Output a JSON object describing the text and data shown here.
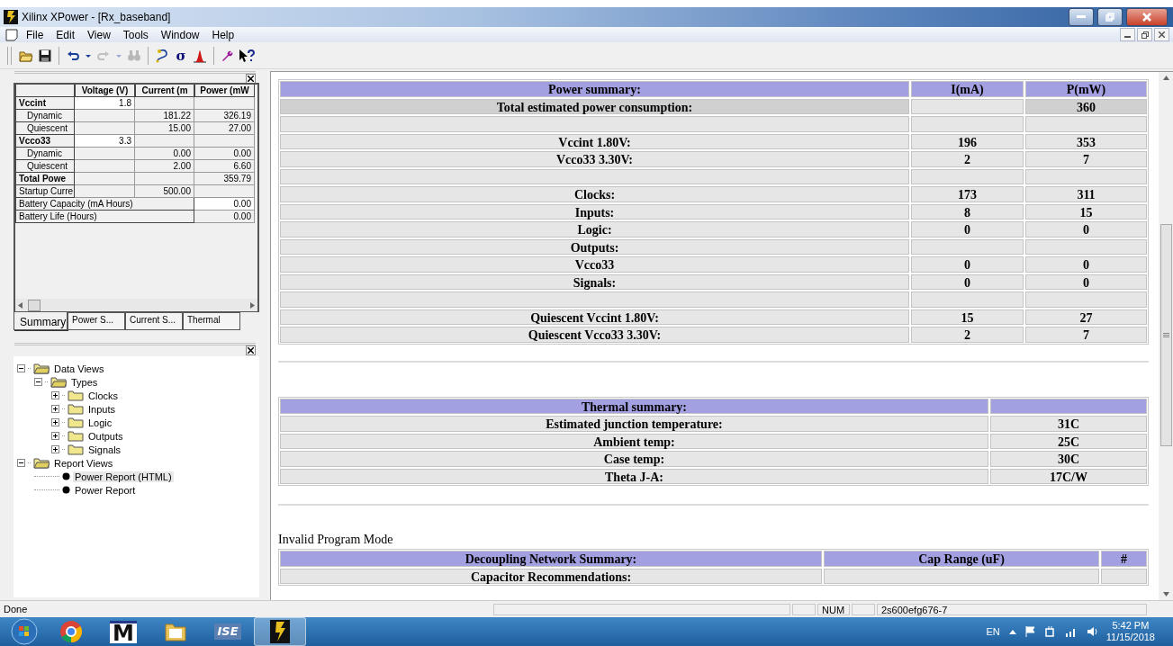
{
  "window": {
    "title": "Xilinx XPower - [Rx_baseband]"
  },
  "menu": [
    "File",
    "Edit",
    "View",
    "Tools",
    "Window",
    "Help"
  ],
  "toolbar": [
    {
      "kind": "open",
      "disabled": false
    },
    {
      "kind": "save",
      "disabled": false
    },
    {
      "kind": "sep"
    },
    {
      "kind": "undo",
      "disabled": false
    },
    {
      "kind": "drop",
      "disabled": false
    },
    {
      "kind": "redo",
      "disabled": true
    },
    {
      "kind": "drop",
      "disabled": true
    },
    {
      "kind": "find",
      "disabled": true
    },
    {
      "kind": "sep"
    },
    {
      "kind": "probe",
      "disabled": false
    },
    {
      "kind": "glyph",
      "text": "σ",
      "disabled": false
    },
    {
      "kind": "peak",
      "disabled": false
    },
    {
      "kind": "sep"
    },
    {
      "kind": "wrench",
      "disabled": false
    },
    {
      "kind": "help",
      "disabled": false
    }
  ],
  "grid": {
    "columns": [
      "Voltage (V)",
      "Current (m",
      "Power (mW"
    ],
    "rows": [
      {
        "kind": "group",
        "label": "Vccint",
        "voltage": "1.8"
      },
      {
        "kind": "sub",
        "label": "Dynamic",
        "current": "181.22",
        "power": "326.19"
      },
      {
        "kind": "sub",
        "label": "Quiescent",
        "current": "15.00",
        "power": "27.00"
      },
      {
        "kind": "group",
        "label": "Vcco33",
        "voltage": "3.3"
      },
      {
        "kind": "sub",
        "label": "Dynamic",
        "current": "0.00",
        "power": "0.00"
      },
      {
        "kind": "sub",
        "label": "Quiescent",
        "current": "2.00",
        "power": "6.60"
      },
      {
        "kind": "total",
        "label": "Total Powe",
        "power": "359.79"
      },
      {
        "kind": "plain",
        "label": "Startup Curre",
        "current": "500.00"
      },
      {
        "kind": "wide-input",
        "label": "Battery Capacity (mA Hours)",
        "value": "0.00"
      },
      {
        "kind": "wide",
        "label": "Battery Life (Hours)",
        "value": "0.00"
      }
    ]
  },
  "panel_tabs": [
    {
      "label": "Summary",
      "selected": true
    },
    {
      "label": "Power S...",
      "selected": false
    },
    {
      "label": "Current S...",
      "selected": false
    },
    {
      "label": "Thermal",
      "selected": false
    }
  ],
  "tree": [
    {
      "label": "Data Views",
      "expanded": true,
      "selected": false,
      "children": [
        {
          "label": "Types",
          "expanded": true,
          "selected": false,
          "children": [
            {
              "label": "Clocks",
              "expanded": false,
              "selected": false
            },
            {
              "label": "Inputs",
              "expanded": false,
              "selected": false
            },
            {
              "label": "Logic",
              "expanded": false,
              "selected": false
            },
            {
              "label": "Outputs",
              "expanded": false,
              "selected": false
            },
            {
              "label": "Signals",
              "expanded": false,
              "selected": false
            }
          ]
        }
      ]
    },
    {
      "label": "Report Views",
      "expanded": true,
      "selected": false,
      "children": [
        {
          "label": "Power Report (HTML)",
          "selected": true
        },
        {
          "label": "Power Report",
          "selected": false
        }
      ]
    }
  ],
  "power_summary": {
    "columns": [
      "Power summary:",
      "I(mA)",
      "P(mW)"
    ],
    "rows": [
      {
        "kind": "total",
        "label": "Total estimated power consumption:",
        "power": "360"
      },
      {
        "kind": "blank"
      },
      {
        "kind": "row",
        "label": "Vccint 1.80V:",
        "current": "196",
        "power": "353"
      },
      {
        "kind": "row",
        "label": "Vcco33 3.30V:",
        "current": "2",
        "power": "7"
      },
      {
        "kind": "blank"
      },
      {
        "kind": "row",
        "label": "Clocks:",
        "current": "173",
        "power": "311"
      },
      {
        "kind": "row",
        "label": "Inputs:",
        "current": "8",
        "power": "15"
      },
      {
        "kind": "row",
        "label": "Logic:",
        "current": "0",
        "power": "0"
      },
      {
        "kind": "row",
        "label": "Outputs:"
      },
      {
        "kind": "row",
        "label": "Vcco33",
        "current": "0",
        "power": "0"
      },
      {
        "kind": "row",
        "label": "Signals:",
        "current": "0",
        "power": "0"
      },
      {
        "kind": "blank"
      },
      {
        "kind": "row",
        "label": "Quiescent Vccint 1.80V:",
        "current": "15",
        "power": "27"
      },
      {
        "kind": "row",
        "label": "Quiescent Vcco33 3.30V:",
        "current": "2",
        "power": "7"
      }
    ]
  },
  "thermal_summary": {
    "columns": [
      "Thermal summary:"
    ],
    "rows": [
      {
        "label": "Estimated junction temperature:",
        "value": "31C"
      },
      {
        "label": "Ambient temp:",
        "value": "25C"
      },
      {
        "label": "Case temp:",
        "value": "30C"
      },
      {
        "label": "Theta J-A:",
        "value": "17C/W"
      }
    ]
  },
  "decoupling": {
    "note": "Invalid Program Mode",
    "columns": [
      "Decoupling Network Summary:",
      "Cap Range (uF)",
      "#"
    ],
    "rows": [
      {
        "label": "Capacitor Recommendations:"
      }
    ]
  },
  "status_bar": {
    "message": "Done",
    "num": "NUM",
    "device": "2s600efg676-7"
  },
  "taskbar": {
    "apps": [
      {
        "kind": "start",
        "selected": false
      },
      {
        "kind": "browser",
        "selected": false
      },
      {
        "kind": "text",
        "text": "M",
        "selected": false
      },
      {
        "kind": "folder",
        "selected": false
      },
      {
        "kind": "text",
        "text": "ISE",
        "selected": false
      },
      {
        "kind": "xilinx",
        "selected": true
      }
    ],
    "language": "EN",
    "time": "5:42 PM",
    "date": "11/15/2018"
  }
}
